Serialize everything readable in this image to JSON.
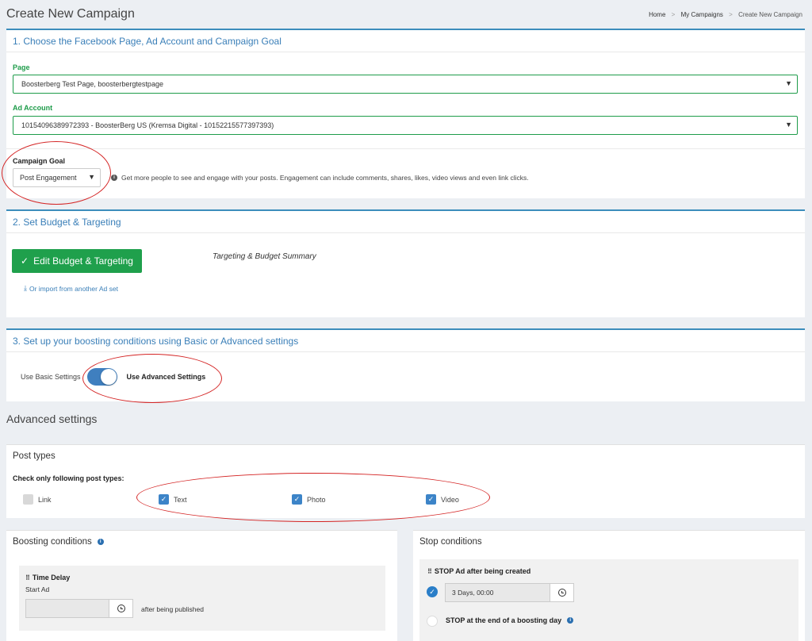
{
  "header": {
    "title": "Create New Campaign",
    "breadcrumb": [
      "Home",
      "My Campaigns",
      "Create New Campaign"
    ],
    "breadcrumb_sep": ">"
  },
  "section1": {
    "title": "1. Choose the Facebook Page, Ad Account and Campaign Goal",
    "page_label": "Page",
    "page_value": "Boosterberg Test Page, boosterbergtestpage",
    "ad_account_label": "Ad Account",
    "ad_account_value": "10154096389972393 - BoosterBerg US (Kremsa Digital - 10152215577397393)",
    "goal_label": "Campaign Goal",
    "goal_value": "Post Engagement",
    "goal_help": "Get more people to see and engage with your posts. Engagement can include comments, shares, likes, video views and even link clicks."
  },
  "section2": {
    "title": "2. Set Budget & Targeting",
    "edit_button": "Edit Budget & Targeting",
    "import_link": "Or import from another Ad set",
    "summary": "Targeting & Budget Summary"
  },
  "section3": {
    "title": "3. Set up your boosting conditions using Basic or Advanced settings",
    "basic_label": "Use Basic Settings",
    "advanced_label": "Use Advanced Settings",
    "advanced_on": true
  },
  "advanced": {
    "heading": "Advanced settings",
    "post_types": {
      "title": "Post types",
      "label": "Check only following post types:",
      "items": [
        {
          "label": "Link",
          "checked": false
        },
        {
          "label": "Text",
          "checked": true
        },
        {
          "label": "Photo",
          "checked": true
        },
        {
          "label": "Video",
          "checked": true
        }
      ]
    },
    "boosting": {
      "title": "Boosting conditions",
      "time_delay_title": "Time Delay",
      "start_ad": "Start Ad",
      "input_value": "",
      "after_text": "after being published"
    },
    "stop": {
      "title": "Stop conditions",
      "stop_after_title": "STOP Ad after being created",
      "duration_value": "3 Days, 00:00",
      "stop_end_day": "STOP at the end of a boosting day"
    }
  },
  "colors": {
    "accent_blue": "#3c8dbc",
    "green": "#1fa04c",
    "annotation_red": "#d42424"
  }
}
